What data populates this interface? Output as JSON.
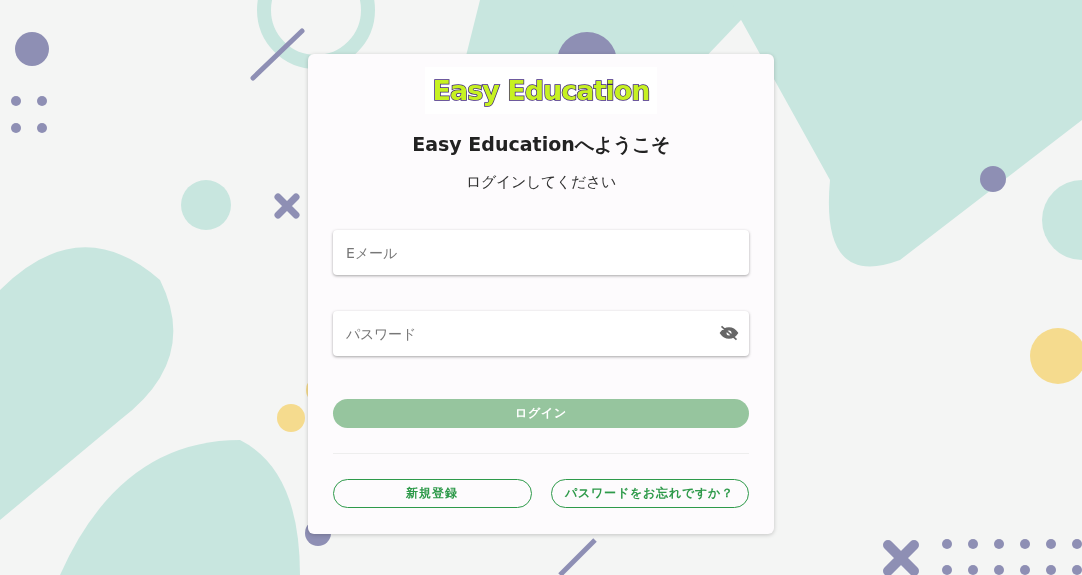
{
  "logo": {
    "text": "Easy Education"
  },
  "heading": "Easy Educationへようこそ",
  "subtitle": "ログインしてください",
  "fields": [
    {
      "kind": "text",
      "placeholder": "Eメール"
    },
    {
      "kind": "password",
      "placeholder": "パスワード"
    }
  ],
  "login_button": {
    "label": "ログイン",
    "disabled": true
  },
  "links": [
    "新規登録",
    "パスワードをお忘れですか？"
  ]
}
